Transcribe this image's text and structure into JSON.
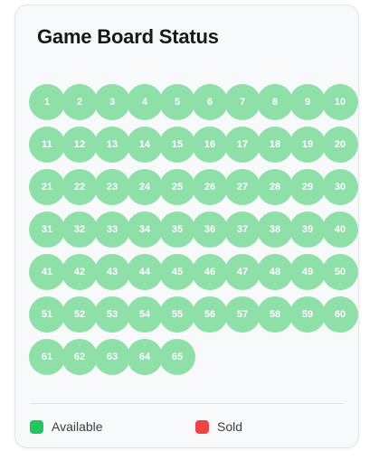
{
  "header": {
    "title": "Game Board Status"
  },
  "board": {
    "columns": 10,
    "cells": [
      {
        "n": "1",
        "status": "available"
      },
      {
        "n": "2",
        "status": "available"
      },
      {
        "n": "3",
        "status": "available"
      },
      {
        "n": "4",
        "status": "available"
      },
      {
        "n": "5",
        "status": "available"
      },
      {
        "n": "6",
        "status": "available"
      },
      {
        "n": "7",
        "status": "available"
      },
      {
        "n": "8",
        "status": "available"
      },
      {
        "n": "9",
        "status": "available"
      },
      {
        "n": "10",
        "status": "available"
      },
      {
        "n": "11",
        "status": "available"
      },
      {
        "n": "12",
        "status": "available"
      },
      {
        "n": "13",
        "status": "available"
      },
      {
        "n": "14",
        "status": "available"
      },
      {
        "n": "15",
        "status": "available"
      },
      {
        "n": "16",
        "status": "available"
      },
      {
        "n": "17",
        "status": "available"
      },
      {
        "n": "18",
        "status": "available"
      },
      {
        "n": "19",
        "status": "available"
      },
      {
        "n": "20",
        "status": "available"
      },
      {
        "n": "21",
        "status": "available"
      },
      {
        "n": "22",
        "status": "available"
      },
      {
        "n": "23",
        "status": "available"
      },
      {
        "n": "24",
        "status": "available"
      },
      {
        "n": "25",
        "status": "available"
      },
      {
        "n": "26",
        "status": "available"
      },
      {
        "n": "27",
        "status": "available"
      },
      {
        "n": "28",
        "status": "available"
      },
      {
        "n": "29",
        "status": "available"
      },
      {
        "n": "30",
        "status": "available"
      },
      {
        "n": "31",
        "status": "available"
      },
      {
        "n": "32",
        "status": "available"
      },
      {
        "n": "33",
        "status": "available"
      },
      {
        "n": "34",
        "status": "available"
      },
      {
        "n": "35",
        "status": "available"
      },
      {
        "n": "36",
        "status": "available"
      },
      {
        "n": "37",
        "status": "available"
      },
      {
        "n": "38",
        "status": "available"
      },
      {
        "n": "39",
        "status": "available"
      },
      {
        "n": "40",
        "status": "available"
      },
      {
        "n": "41",
        "status": "available"
      },
      {
        "n": "42",
        "status": "available"
      },
      {
        "n": "43",
        "status": "available"
      },
      {
        "n": "44",
        "status": "available"
      },
      {
        "n": "45",
        "status": "available"
      },
      {
        "n": "46",
        "status": "available"
      },
      {
        "n": "47",
        "status": "available"
      },
      {
        "n": "48",
        "status": "available"
      },
      {
        "n": "49",
        "status": "available"
      },
      {
        "n": "50",
        "status": "available"
      },
      {
        "n": "51",
        "status": "available"
      },
      {
        "n": "52",
        "status": "available"
      },
      {
        "n": "53",
        "status": "available"
      },
      {
        "n": "54",
        "status": "available"
      },
      {
        "n": "55",
        "status": "available"
      },
      {
        "n": "56",
        "status": "available"
      },
      {
        "n": "57",
        "status": "available"
      },
      {
        "n": "58",
        "status": "available"
      },
      {
        "n": "59",
        "status": "available"
      },
      {
        "n": "60",
        "status": "available"
      },
      {
        "n": "61",
        "status": "available"
      },
      {
        "n": "62",
        "status": "available"
      },
      {
        "n": "63",
        "status": "available"
      },
      {
        "n": "64",
        "status": "available"
      },
      {
        "n": "65",
        "status": "available"
      }
    ]
  },
  "legend": {
    "available_label": "Available",
    "sold_label": "Sold"
  },
  "colors": {
    "available_cell": "#8fe0a8",
    "available_swatch": "#22c55e",
    "sold": "#ef4444"
  }
}
